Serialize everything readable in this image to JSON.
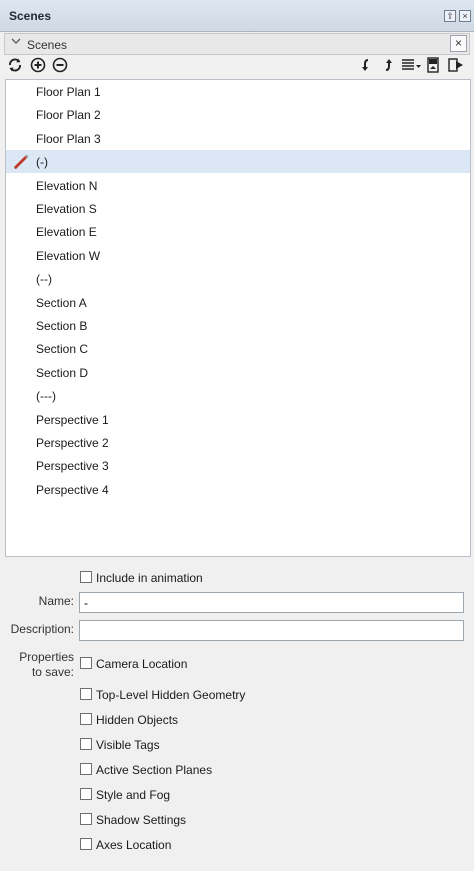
{
  "window": {
    "title": "Scenes"
  },
  "tray": {
    "section_label": "Scenes",
    "close_glyph": "×",
    "pin_glyph": "⇧",
    "close_window_glyph": "×"
  },
  "toolbar": {
    "icons": [
      "refresh-icon",
      "add-scene-icon",
      "remove-scene-icon",
      "move-scene-down-icon",
      "move-scene-up-icon",
      "view-options-icon",
      "show-details-icon",
      "update-scene-icon"
    ]
  },
  "scenes": {
    "selected_index": 3,
    "items": [
      {
        "label": "Floor Plan 1"
      },
      {
        "label": "Floor Plan 2"
      },
      {
        "label": "Floor Plan 3"
      },
      {
        "label": "(-)"
      },
      {
        "label": "Elevation N"
      },
      {
        "label": "Elevation S"
      },
      {
        "label": "Elevation E"
      },
      {
        "label": "Elevation W"
      },
      {
        "label": "(--)"
      },
      {
        "label": "Section A"
      },
      {
        "label": "Section B"
      },
      {
        "label": "Section C"
      },
      {
        "label": "Section D"
      },
      {
        "label": "(---)"
      },
      {
        "label": "Perspective 1"
      },
      {
        "label": "Perspective 2"
      },
      {
        "label": "Perspective 3"
      },
      {
        "label": "Perspective 4"
      }
    ]
  },
  "properties": {
    "include_animation_label": "Include in animation",
    "name_label": "Name:",
    "name_value": "-",
    "description_label": "Description:",
    "description_value": "",
    "properties_label_1": "Properties",
    "properties_label_2": "to save:",
    "checkboxes": [
      {
        "label": "Camera Location",
        "checked": false
      },
      {
        "label": "Top-Level Hidden Geometry",
        "checked": false
      },
      {
        "label": "Hidden Objects",
        "checked": false
      },
      {
        "label": "Visible Tags",
        "checked": false
      },
      {
        "label": "Active Section Planes",
        "checked": false
      },
      {
        "label": "Style and Fog",
        "checked": false
      },
      {
        "label": "Shadow Settings",
        "checked": false
      },
      {
        "label": "Axes Location",
        "checked": false
      }
    ]
  },
  "colors": {
    "selection": "#dce7f5",
    "pencil": "#c0392b",
    "titlebar": "#d6dee8"
  }
}
